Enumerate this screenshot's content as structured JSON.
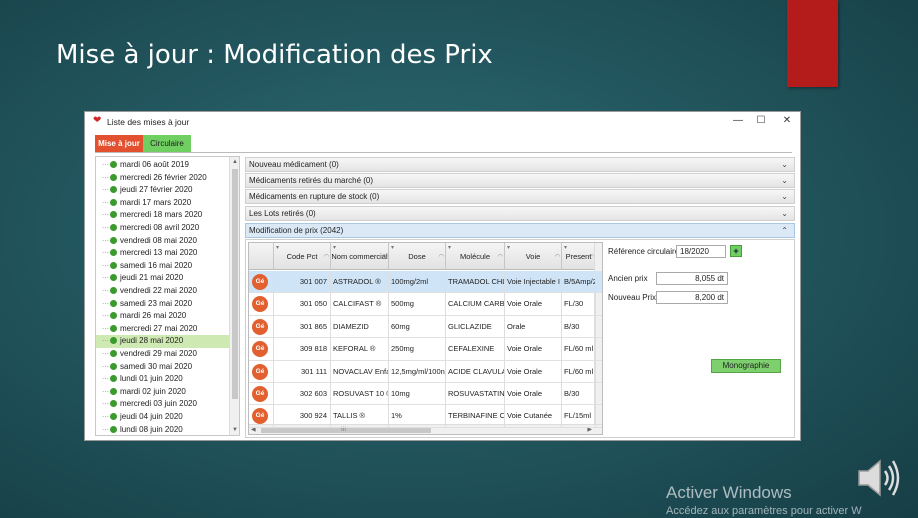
{
  "slide": {
    "title": "Mise à jour : Modification des Prix"
  },
  "window": {
    "title": "Liste des mises à jour",
    "minimize": "—",
    "maximize": "☐",
    "close": "✕",
    "logo": "❤"
  },
  "tabs": [
    {
      "label": "Mise à jour",
      "active": true
    },
    {
      "label": "Circulaire",
      "active": false
    }
  ],
  "dates": [
    "mardi 06 août 2019",
    "mercredi 26 février 2020",
    "jeudi 27 février 2020",
    "mardi 17 mars 2020",
    "mercredi 18 mars 2020",
    "mercredi 08 avril 2020",
    "vendredi 08 mai 2020",
    "mercredi 13 mai 2020",
    "samedi 16 mai 2020",
    "jeudi 21 mai 2020",
    "vendredi 22 mai 2020",
    "samedi 23 mai 2020",
    "mardi 26 mai 2020",
    "mercredi 27 mai 2020",
    "jeudi 28 mai 2020",
    "vendredi 29 mai 2020",
    "samedi 30 mai 2020",
    "lundi 01 juin 2020",
    "mardi 02 juin 2020",
    "mercredi 03 juin 2020",
    "jeudi 04 juin 2020",
    "lundi 08 juin 2020"
  ],
  "selected_date_index": 14,
  "sections": [
    {
      "label": "Nouveau médicament   (0)",
      "open": false
    },
    {
      "label": "Médicaments retirés du marché   (0)",
      "open": false
    },
    {
      "label": "Médicaments en rupture de stock   (0)",
      "open": false
    },
    {
      "label": "Les Lots retirés   (0)",
      "open": false
    },
    {
      "label": "Modification de prix   (2042)",
      "open": true
    }
  ],
  "grid": {
    "columns": [
      "Code Pct",
      "Nom commercial",
      "Dose",
      "Molécule",
      "Voie",
      "Present"
    ],
    "rows": [
      {
        "badge": "Gé",
        "code": "301 007",
        "nom": "ASTRADOL  ®",
        "dose": "100mg/2ml",
        "molecule": "TRAMADOL CHLI",
        "voie": "Voie Injectable I",
        "present": "B/5Amp/2"
      },
      {
        "badge": "Gé",
        "code": "301 050",
        "nom": "CALCIFAST ®",
        "dose": "500mg",
        "molecule": "CALCIUM CARBI",
        "voie": "Voie Orale",
        "present": "FL/30"
      },
      {
        "badge": "Gé",
        "code": "301 865",
        "nom": "DIAMEZID",
        "dose": "60mg",
        "molecule": "GLICLAZIDE",
        "voie": "Orale",
        "present": "B/30"
      },
      {
        "badge": "Gé",
        "code": "309 818",
        "nom": "KEFORAL ®",
        "dose": "250mg",
        "molecule": "CEFALEXINE",
        "voie": "Voie Orale",
        "present": "FL/60 ml"
      },
      {
        "badge": "Gé",
        "code": "301 111",
        "nom": "NOVACLAV Enfa",
        "dose": "12,5mg/ml/100n",
        "molecule": "ACIDE CLAVULA",
        "voie": "Voie Orale",
        "present": "FL/60 ml"
      },
      {
        "badge": "Gé",
        "code": "302 603",
        "nom": "ROSUVAST 10 ®",
        "dose": "10mg",
        "molecule": "ROSUVASTATINE",
        "voie": "Voie Orale",
        "present": "B/30"
      },
      {
        "badge": "Gé",
        "code": "300 924",
        "nom": "TALLIS  ®",
        "dose": "1%",
        "molecule": "TERBINAFINE CI",
        "voie": "Voie Cutanée",
        "present": "FL/15ml"
      }
    ],
    "selected_row_index": 0,
    "scroll_marker": "III"
  },
  "price_panel": {
    "ref_label": "Référence circulaire",
    "ref_value": "18/2020",
    "add_label": "+",
    "old_price_label": "Ancien prix",
    "old_price_value": "8,055 dt",
    "new_price_label": "Nouveau Prix",
    "new_price_value": "8,200 dt",
    "monographie_label": "Monographie"
  },
  "watermark": {
    "line1": "Activer Windows",
    "line2": "Accédez aux paramètres pour activer W"
  },
  "colors": {
    "accent_orange": "#e2502f",
    "accent_green": "#6fcf61",
    "brand_red": "#b41c1c"
  }
}
